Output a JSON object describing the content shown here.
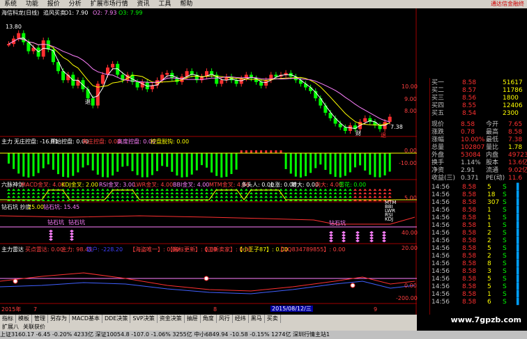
{
  "menu": [
    "系统",
    "功能",
    "报价",
    "分析",
    "扩展市场行情",
    "资讯",
    "工具",
    "帮助"
  ],
  "ad": "通达信金融终",
  "main": {
    "title": "海信科龙(日线)",
    "indicator": "追风买卖",
    "o1": "O1: 7.90",
    "o2": "O2: 7.93",
    "o3": "O3: 7.99",
    "price_top": "13.80",
    "price_low": "7.38",
    "tag_left": "退",
    "tag_cai": "财",
    "tag_tui": "退",
    "candles": [
      12.6,
      12.9,
      13.2,
      12.7,
      12.2,
      12.4,
      11.9,
      12.8,
      12.3,
      11.6,
      11.1,
      10.6,
      10.9,
      10.3,
      10.6,
      10.1,
      9.6,
      9.2,
      10.4,
      10.9,
      11.3,
      11.5,
      10.9,
      10.6,
      10.9,
      10.5,
      10.2,
      10.5,
      10.1,
      10.3,
      10.6,
      10.9,
      11.0,
      10.7,
      10.5,
      10.8,
      11.1,
      10.9,
      10.6,
      10.8,
      11.1,
      10.9,
      10.4,
      10.6,
      10.8,
      10.6,
      10.4,
      10.7,
      10.9,
      10.7,
      10.5,
      10.3,
      10.6,
      10.9,
      10.8,
      10.9,
      11.0,
      10.8,
      10.6,
      10.4,
      10.2,
      10.0,
      9.6,
      9.2,
      8.8,
      8.5,
      8.2,
      8.0,
      7.8,
      8.1,
      7.9,
      8.3,
      8.5,
      8.3,
      8.1,
      7.9,
      8.3,
      8.58
    ]
  },
  "p2": {
    "title": "主力",
    "l1": "无庄控盘: -16.81",
    "l2": "开始控盘: 0.00",
    "l3": "有庄控盘: 0.00",
    "l4": "高度控盘: 0.00",
    "l5": "控盘脱钩: 0.00"
  },
  "p3": {
    "title": "六脉神剑",
    "l1": "MACD金叉: 4.00",
    "l2": "KDJ金叉: 2.00",
    "l3": "RSI金叉: 3.00",
    "l4": "LWR金叉: 4.00",
    "l5": "BBI金叉: 4.00",
    "l6": "MTM金叉: 4.00",
    "l7": "多头人: 0.00",
    "l8": "上涨: 0.00",
    "l9": "转大: 0.00",
    "l10": "向大: 4.00",
    "l11": "雪花: 0.00",
    "tags": [
      "MTM",
      "BBI",
      "LWR",
      "RSI",
      "KDJ"
    ]
  },
  "p4": {
    "title": "钻石坑 抄底",
    "l1": "25.00",
    "l2": "钻石坑: 15.45",
    "tag": "钻石坑"
  },
  "p5": {
    "title": "主力雷达",
    "l1": "买点雷达: 0.00",
    "l2": "主力: 98.43",
    "l3": "散户: -228.20",
    "l4": "【海盗唯一】: 0.00",
    "l5": "【指标更新】: 0.00",
    "l6": "【正新卖家】: 0.00",
    "l7": "【小王子87】: 0.00",
    "l8": "【QQ834789855】: 0.00"
  },
  "axis": {
    "a1": "10.00",
    "a2": "9.00",
    "a3": "8.00",
    "a4": "0.00",
    "a5": "-10.00",
    "a6": "5.00",
    "a7": "40.00",
    "a8": "20.00",
    "a9": "0.00",
    "a10": "-200.00"
  },
  "timeline": {
    "year": "2015年",
    "m7": "7",
    "m8": "8",
    "date": "2015/08/12/三",
    "m9": "9",
    "right": "日线"
  },
  "quote": [
    {
      "k": "买一",
      "v": "8.58",
      "n": "51617"
    },
    {
      "k": "买二",
      "v": "8.57",
      "n": "11786"
    },
    {
      "k": "买三",
      "v": "8.56",
      "n": "1800"
    },
    {
      "k": "买四",
      "v": "8.55",
      "n": "12406"
    },
    {
      "k": "买五",
      "v": "8.54",
      "n": "2300"
    }
  ],
  "stats": [
    {
      "a": "现价",
      "b": "8.58",
      "c": "今开",
      "d": "7.65"
    },
    {
      "a": "涨跌",
      "b": "0.78",
      "c": "最高",
      "d": "8.58"
    },
    {
      "a": "涨幅",
      "b": "10.00%",
      "c": "最低",
      "d": "7.38"
    },
    {
      "a": "总量",
      "b": "102807",
      "c": "量比",
      "d": "1.78"
    },
    {
      "a": "外盘",
      "b": "53084",
      "c": "内盘",
      "d": "49723"
    },
    {
      "a": "换手",
      "b": "1.14%",
      "c": "股本",
      "d": "13.6亿"
    },
    {
      "a": "净资",
      "b": "2.91",
      "c": "流通",
      "d": "9.02亿"
    },
    {
      "a": "收益(三)",
      "b": "0.371",
      "c": "PE(动)",
      "d": "11.6"
    }
  ],
  "ticks": [
    {
      "t": "14:56",
      "p": "8.58",
      "v": "5",
      "s": "S"
    },
    {
      "t": "14:56",
      "p": "8.58",
      "v": "18",
      "s": "S"
    },
    {
      "t": "14:56",
      "p": "8.58",
      "v": "307",
      "s": "S"
    },
    {
      "t": "14:56",
      "p": "8.58",
      "v": "1",
      "s": "S"
    },
    {
      "t": "14:56",
      "p": "8.58",
      "v": "1",
      "s": "S"
    },
    {
      "t": "14:56",
      "p": "8.58",
      "v": "1",
      "s": "S"
    },
    {
      "t": "14:56",
      "p": "8.58",
      "v": "2",
      "s": "S"
    },
    {
      "t": "14:56",
      "p": "8.58",
      "v": "2",
      "s": "S"
    },
    {
      "t": "14:56",
      "p": "8.58",
      "v": "5",
      "s": "S"
    },
    {
      "t": "14:56",
      "p": "8.58",
      "v": "2",
      "s": "S"
    },
    {
      "t": "14:56",
      "p": "8.58",
      "v": "8",
      "s": "S"
    },
    {
      "t": "14:56",
      "p": "8.58",
      "v": "3",
      "s": "S"
    },
    {
      "t": "14:56",
      "p": "8.58",
      "v": "5",
      "s": "S"
    },
    {
      "t": "14:56",
      "p": "8.58",
      "v": "5",
      "s": "S"
    },
    {
      "t": "14:56",
      "p": "8.58",
      "v": "1",
      "s": "S"
    },
    {
      "t": "14:56",
      "p": "8.58",
      "v": "6",
      "s": "S"
    }
  ],
  "tabs": [
    "指标",
    "模板",
    "管理",
    "另存为",
    "MACD基本",
    "DDE决策",
    "SVP决策",
    "资金决策",
    "抽屉",
    "角度",
    "风行",
    "经纬",
    "黑马",
    "买卖"
  ],
  "tabs2": [
    "扩展八",
    "关联获价"
  ],
  "status": "上证3160.17  -6.45  -0.20%  4233亿   深证10054.8  -107.0  -1.06%  3255亿   中小6849.94  -10.58  -0.15%  1274亿   深圳行情主站1",
  "watermark": "www.7gpzb.com",
  "colors": {
    "up": "#ff3030",
    "down": "#00ff00",
    "bg": "#000000"
  }
}
